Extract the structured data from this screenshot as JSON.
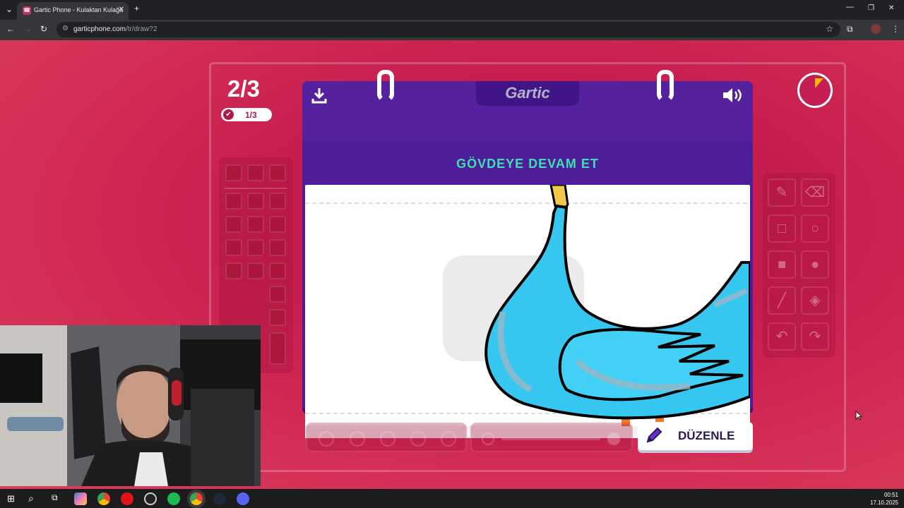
{
  "browser": {
    "tab_title": "Gartic Phone - Kulaktan Kulağa",
    "tab_close": "✕",
    "new_tab": "+",
    "url_host": "garticphone.com",
    "url_path": "/tr/draw?2"
  },
  "game": {
    "logo": "Gartic",
    "round": "2/3",
    "done_count": "1/3",
    "prompt": "GÖVDEYE DEVAM ET",
    "edit_button": "DÜZENLE"
  },
  "taskbar": {
    "time": "00:51",
    "date": "17.10.2025"
  },
  "colors": {
    "page_bg": "#c61d4f",
    "notebook": "#56219e",
    "prompt_text": "#3fe0b0",
    "bird_fill": "#35c7f0"
  }
}
